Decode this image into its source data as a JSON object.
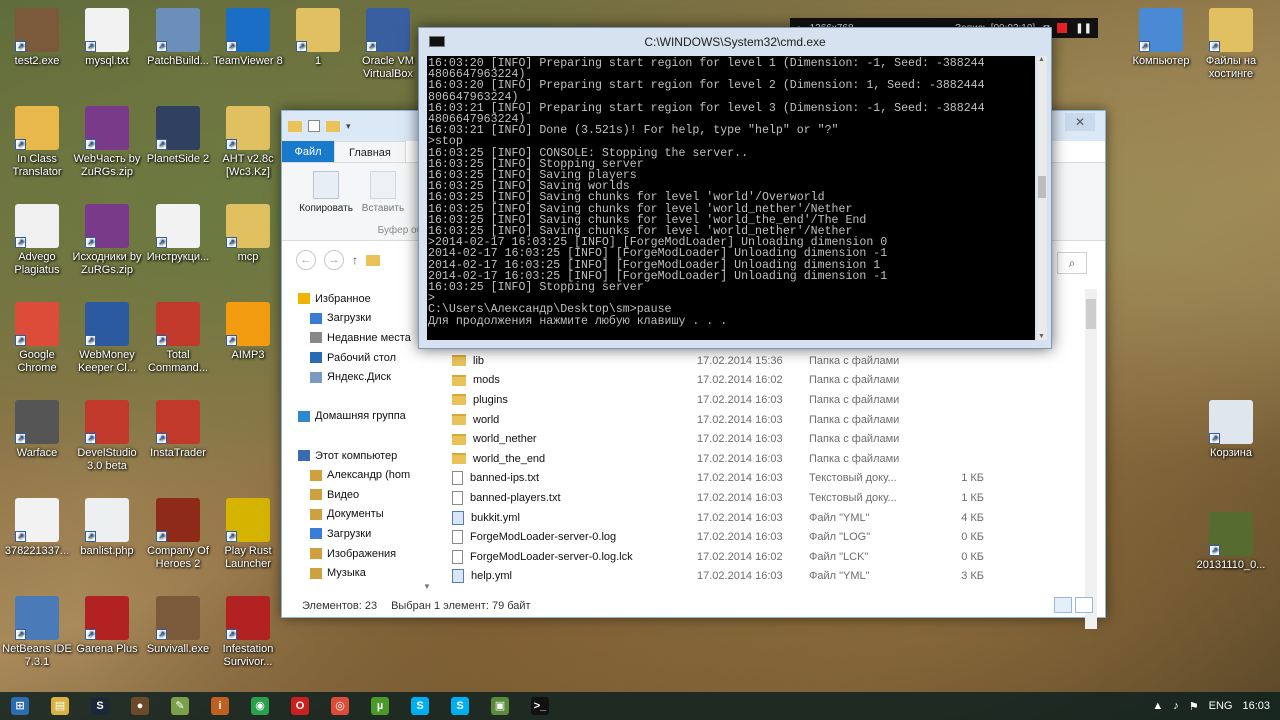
{
  "desktop_icons": [
    {
      "label": "test2.exe",
      "color": "#7a5a3a"
    },
    {
      "label": "mysql.txt",
      "color": "#f2f2f2"
    },
    {
      "label": "PatchBuild...",
      "color": "#6b8fb8"
    },
    {
      "label": "TeamViewer 8",
      "color": "#1a6fc4"
    },
    {
      "label": "1",
      "color": "#e0c060"
    },
    {
      "label": "Oracle VM VirtualBox",
      "color": "#3a5fa0"
    },
    {
      "label": "In Class Translator",
      "color": "#e8b84a"
    },
    {
      "label": "WebЧасть by ZuRGs.zip",
      "color": "#7a3a8a"
    },
    {
      "label": "PlanetSide 2",
      "color": "#304060"
    },
    {
      "label": "AHT v2.8c [Wc3.Kz]",
      "color": "#e0c060"
    },
    {
      "label": "Advego Plagiatus",
      "color": "#f0f0f0"
    },
    {
      "label": "Исходники by ZuRGs.zip",
      "color": "#7a3a8a"
    },
    {
      "label": "Инструкци...",
      "color": "#f2f2f2"
    },
    {
      "label": "mcp",
      "color": "#e0c060"
    },
    {
      "label": "Google Chrome",
      "color": "#dd4b39"
    },
    {
      "label": "WebMoney Keeper Cl...",
      "color": "#2c5aa0"
    },
    {
      "label": "Total Command...",
      "color": "#c0392b"
    },
    {
      "label": "AIMP3",
      "color": "#f39c12"
    },
    {
      "label": "Warface",
      "color": "#555555"
    },
    {
      "label": "DevelStudio 3.0 beta",
      "color": "#c0392b"
    },
    {
      "label": "InstaTrader",
      "color": "#c0392b"
    },
    {
      "label": "378221337...",
      "color": "#f2f2f2"
    },
    {
      "label": "banlist.php",
      "color": "#ecf0f1"
    },
    {
      "label": "Company Of Heroes 2",
      "color": "#8e2a1a"
    },
    {
      "label": "Play Rust Launcher",
      "color": "#d4b400"
    },
    {
      "label": "NetBeans IDE 7.3.1",
      "color": "#4a7ab8"
    },
    {
      "label": "Garena Plus",
      "color": "#b22222"
    },
    {
      "label": "Survivall.exe",
      "color": "#7a5a3a"
    },
    {
      "label": "Infestation Survivor...",
      "color": "#b22222"
    },
    {
      "label": "Компьютер",
      "color": "#4a8ad4"
    },
    {
      "label": "Файлы на хостинге",
      "color": "#e0c060"
    },
    {
      "label": "Корзина",
      "color": "#dfe6ee"
    },
    {
      "label": "20131110_0...",
      "color": "#556b2f"
    }
  ],
  "recorder": {
    "resolution": "1366x768",
    "status": "Запись [00:03:10]"
  },
  "cmd": {
    "title": "C:\\WINDOWS\\System32\\cmd.exe",
    "lines": [
      "16:03:20 [INFO] Preparing start region for level 1 (Dimension: -1, Seed: -388244",
      "4806647963224)",
      "16:03:20 [INFO] Preparing start region for level 2 (Dimension: 1, Seed: -3882444",
      "806647963224)",
      "16:03:21 [INFO] Preparing start region for level 3 (Dimension: -1, Seed: -388244",
      "4806647963224)",
      "16:03:21 [INFO] Done (3.521s)! For help, type \"help\" or \"?\"",
      ">stop",
      "16:03:25 [INFO] CONSOLE: Stopping the server..",
      "16:03:25 [INFO] Stopping server",
      "16:03:25 [INFO] Saving players",
      "16:03:25 [INFO] Saving worlds",
      "16:03:25 [INFO] Saving chunks for level 'world'/Overworld",
      "16:03:25 [INFO] Saving chunks for level 'world_nether'/Nether",
      "16:03:25 [INFO] Saving chunks for level 'world_the_end'/The End",
      "16:03:25 [INFO] Saving chunks for level 'world_nether'/Nether",
      ">2014-02-17 16:03:25 [INFO] [ForgeModLoader] Unloading dimension 0",
      "2014-02-17 16:03:25 [INFO] [ForgeModLoader] Unloading dimension -1",
      "2014-02-17 16:03:25 [INFO] [ForgeModLoader] Unloading dimension 1",
      "2014-02-17 16:03:25 [INFO] [ForgeModLoader] Unloading dimension -1",
      "16:03:25 [INFO] Stopping server",
      ">",
      "C:\\Users\\Александр\\Desktop\\sm>pause",
      "Для продолжения нажмите любую клавишу . . ."
    ]
  },
  "explorer": {
    "ribbon_tabs": [
      "Файл",
      "Главная"
    ],
    "ribbon_buttons": {
      "copy": "Копировать",
      "paste": "Вставить",
      "group": "Буфер об"
    },
    "nav_pane": [
      {
        "label": "Избранное",
        "icon": "star",
        "indent": 0
      },
      {
        "label": "Загрузки",
        "icon": "downloads",
        "indent": 1
      },
      {
        "label": "Недавние места",
        "icon": "recent",
        "indent": 1
      },
      {
        "label": "Рабочий стол",
        "icon": "desktop",
        "indent": 1
      },
      {
        "label": "Яндекс.Диск",
        "icon": "cloud",
        "indent": 1
      },
      {
        "label": "",
        "icon": "",
        "indent": 0
      },
      {
        "label": "Домашняя группа",
        "icon": "homegroup",
        "indent": 0
      },
      {
        "label": "",
        "icon": "",
        "indent": 0
      },
      {
        "label": "Этот компьютер",
        "icon": "computer",
        "indent": 0
      },
      {
        "label": "Александр (hom",
        "icon": "user",
        "indent": 1
      },
      {
        "label": "Видео",
        "icon": "video",
        "indent": 1
      },
      {
        "label": "Документы",
        "icon": "documents",
        "indent": 1
      },
      {
        "label": "Загрузки",
        "icon": "downloads",
        "indent": 1
      },
      {
        "label": "Изображения",
        "icon": "pictures",
        "indent": 1
      },
      {
        "label": "Музыка",
        "icon": "music",
        "indent": 1
      }
    ],
    "files": [
      {
        "name": "lib",
        "date": "17.02.2014 15:36",
        "type": "Папка с файлами",
        "size": "",
        "kind": "folder"
      },
      {
        "name": "mods",
        "date": "17.02.2014 16:02",
        "type": "Папка с файлами",
        "size": "",
        "kind": "folder"
      },
      {
        "name": "plugins",
        "date": "17.02.2014 16:03",
        "type": "Папка с файлами",
        "size": "",
        "kind": "folder"
      },
      {
        "name": "world",
        "date": "17.02.2014 16:03",
        "type": "Папка с файлами",
        "size": "",
        "kind": "folder"
      },
      {
        "name": "world_nether",
        "date": "17.02.2014 16:03",
        "type": "Папка с файлами",
        "size": "",
        "kind": "folder"
      },
      {
        "name": "world_the_end",
        "date": "17.02.2014 16:03",
        "type": "Папка с файлами",
        "size": "",
        "kind": "folder"
      },
      {
        "name": "banned-ips.txt",
        "date": "17.02.2014 16:03",
        "type": "Текстовый доку...",
        "size": "1 КБ",
        "kind": "doc"
      },
      {
        "name": "banned-players.txt",
        "date": "17.02.2014 16:03",
        "type": "Текстовый доку...",
        "size": "1 КБ",
        "kind": "doc"
      },
      {
        "name": "bukkit.yml",
        "date": "17.02.2014 16:03",
        "type": "Файл \"YML\"",
        "size": "4 КБ",
        "kind": "yml"
      },
      {
        "name": "ForgeModLoader-server-0.log",
        "date": "17.02.2014 16:03",
        "type": "Файл \"LOG\"",
        "size": "0 КБ",
        "kind": "doc"
      },
      {
        "name": "ForgeModLoader-server-0.log.lck",
        "date": "17.02.2014 16:02",
        "type": "Файл \"LCK\"",
        "size": "0 КБ",
        "kind": "doc"
      },
      {
        "name": "help.yml",
        "date": "17.02.2014 16:03",
        "type": "Файл \"YML\"",
        "size": "3 КБ",
        "kind": "yml"
      }
    ],
    "status": {
      "items": "Элементов: 23",
      "selected": "Выбран 1 элемент: 79 байт"
    }
  },
  "taskbar": {
    "apps": [
      {
        "name": "start-button",
        "glyph": "⊞",
        "color": "#2b6cb0"
      },
      {
        "name": "explorer",
        "glyph": "▤",
        "color": "#d9b342"
      },
      {
        "name": "steam",
        "glyph": "S",
        "color": "#1b2838"
      },
      {
        "name": "app-disc",
        "glyph": "●",
        "color": "#6b4a2a"
      },
      {
        "name": "app-tool",
        "glyph": "✎",
        "color": "#7aa04a"
      },
      {
        "name": "app-info",
        "glyph": "i",
        "color": "#c06020"
      },
      {
        "name": "utorrent-green",
        "glyph": "◉",
        "color": "#2aa04a"
      },
      {
        "name": "opera",
        "glyph": "O",
        "color": "#cc1f1f"
      },
      {
        "name": "chrome",
        "glyph": "◎",
        "color": "#dd4b39"
      },
      {
        "name": "utorrent",
        "glyph": "µ",
        "color": "#4a9a2a"
      },
      {
        "name": "skype-1",
        "glyph": "S",
        "color": "#00aff0"
      },
      {
        "name": "skype-2",
        "glyph": "S",
        "color": "#00aff0"
      },
      {
        "name": "minecraft",
        "glyph": "▣",
        "color": "#5a8a3a"
      },
      {
        "name": "cmd",
        "glyph": ">_",
        "color": "#111111"
      }
    ],
    "language": "ENG",
    "time": "16:03"
  }
}
